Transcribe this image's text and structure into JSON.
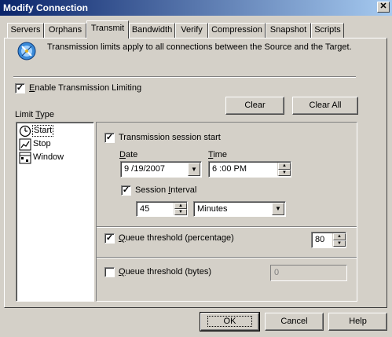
{
  "window": {
    "title": "Modify Connection",
    "close_label": "✕"
  },
  "tabs": [
    "Servers",
    "Orphans",
    "Transmit",
    "Bandwidth",
    "Verify",
    "Compression",
    "Snapshot",
    "Scripts"
  ],
  "info_text": "Transmission limits apply to all connections between the Source and the Target.",
  "enable_limiting": {
    "label": "Enable Transmission Limiting",
    "checked": true
  },
  "limit_type": {
    "label": "Limit Type",
    "items": [
      "Start",
      "Stop",
      "Window"
    ],
    "selected": "Start"
  },
  "buttons": {
    "clear": "Clear",
    "clear_all": "Clear All",
    "ok": "OK",
    "cancel": "Cancel",
    "help": "Help"
  },
  "session_start": {
    "label": "Transmission session start",
    "checked": true,
    "date_label": "Date",
    "date_value": "9 /19/2007",
    "time_label": "Time",
    "time_value": "6 :00 PM",
    "interval_label": "Session Interval",
    "interval_checked": true,
    "interval_value": "45",
    "interval_unit": "Minutes"
  },
  "queue_pct": {
    "label": "Queue threshold (percentage)",
    "checked": true,
    "value": "80"
  },
  "queue_bytes": {
    "label": "Queue threshold (bytes)",
    "checked": false,
    "value": "0"
  },
  "icons": {
    "info": "satellite-dish-icon",
    "start": "clock-icon",
    "stop": "chart-icon",
    "window": "calendar-icon"
  }
}
